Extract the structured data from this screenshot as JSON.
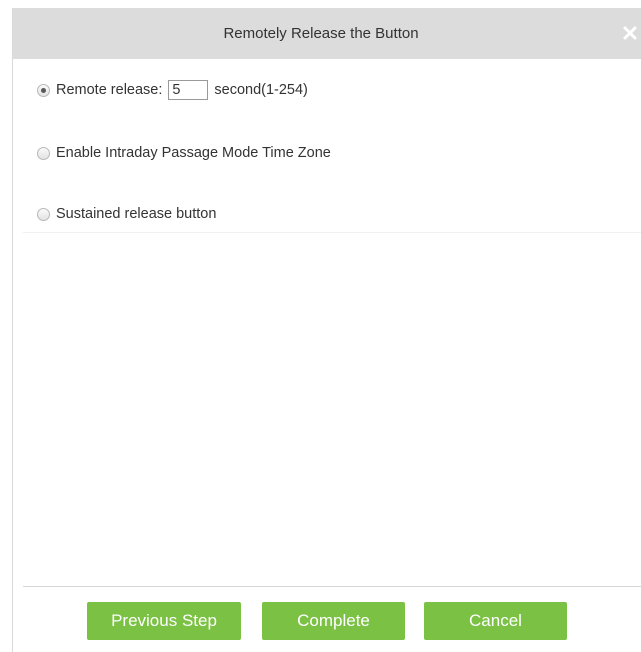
{
  "dialog": {
    "title": "Remotely Release the Button",
    "close_icon": "close-icon"
  },
  "options": {
    "remote_release": {
      "label": "Remote release:",
      "value": "5",
      "unit": "second(1-254)",
      "checked": true
    },
    "intraday_passage": {
      "label": "Enable Intraday Passage Mode Time Zone",
      "checked": false
    },
    "sustained_release": {
      "label": "Sustained release button",
      "checked": false
    }
  },
  "buttons": {
    "previous": "Previous Step",
    "complete": "Complete",
    "cancel": "Cancel"
  },
  "colors": {
    "titlebar": "#dcdcdc",
    "button": "#7bc143"
  }
}
